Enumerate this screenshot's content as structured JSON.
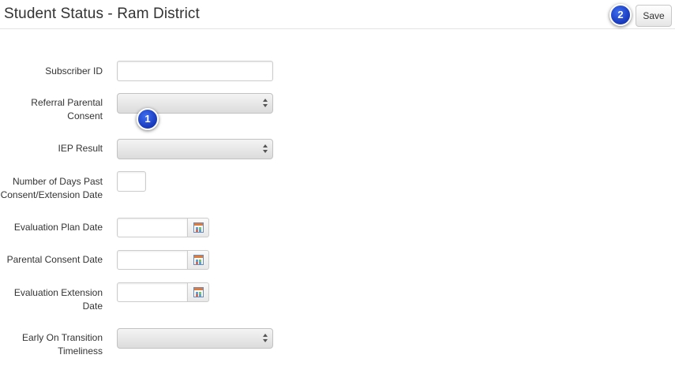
{
  "header": {
    "title": "Student Status - Ram District",
    "save_label": "Save"
  },
  "badges": [
    "1",
    "2"
  ],
  "form": {
    "subscriber_id": {
      "label": "Subscriber ID",
      "value": ""
    },
    "referral_parental_consent": {
      "label_line1": "Referral Parental",
      "label_line2": "Consent",
      "value": ""
    },
    "iep_result": {
      "label": "IEP Result",
      "value": ""
    },
    "days_past": {
      "label_line1": "Number of Days Past",
      "label_line2": "Consent/Extension Date",
      "value": ""
    },
    "evaluation_plan_date": {
      "label": "Evaluation Plan Date",
      "value": ""
    },
    "parental_consent_date": {
      "label": "Parental Consent Date",
      "value": ""
    },
    "evaluation_extension_date": {
      "label_line1": "Evaluation Extension",
      "label_line2": "Date",
      "value": ""
    },
    "early_on_transition": {
      "label_line1": "Early On Transition",
      "label_line2": "Timeliness",
      "value": ""
    }
  },
  "colors": {
    "badge": "#1c3fc2",
    "calendar_accent": "#e07a3a"
  },
  "icons": {
    "calendar": "calendar-icon",
    "select_arrows": "up-down-arrows-icon"
  }
}
